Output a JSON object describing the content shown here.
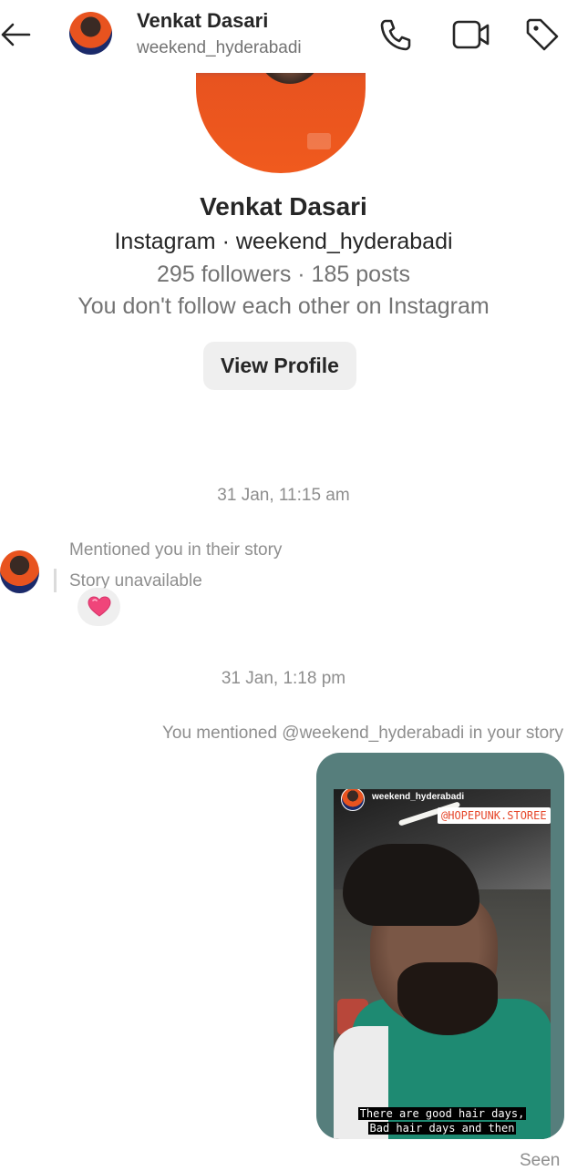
{
  "header": {
    "name": "Venkat Dasari",
    "handle": "weekend_hyderabadi",
    "icons": [
      "back-arrow-icon",
      "phone-icon",
      "video-camera-icon",
      "tag-icon"
    ]
  },
  "profile": {
    "name": "Venkat Dasari",
    "platform_line": "Instagram · weekend_hyderabadi",
    "stats_line": "295 followers · 185 posts",
    "relation_line": "You don't follow each other on Instagram",
    "view_profile_label": "View Profile"
  },
  "thread": {
    "timestamp_1": "31 Jan, 11:15 am",
    "incoming_mention": "Mentioned you in their story",
    "story_unavailable": "Story unavailable",
    "reaction": "💗",
    "timestamp_2": "31 Jan, 1:18 pm",
    "outgoing_mention": "You mentioned @weekend_hyderabadi in your story",
    "story": {
      "username": "weekend_hyderabadi",
      "sticker": "@HOPEPUNK.STOREE",
      "caption_1": "There are good hair days,",
      "caption_2": "Bad hair days and then"
    },
    "seen_label": "Seen"
  },
  "colors": {
    "story_card_bg": "#567e7c",
    "sticker_text": "#e6482c",
    "secondary_text": "#8e8e8e"
  }
}
